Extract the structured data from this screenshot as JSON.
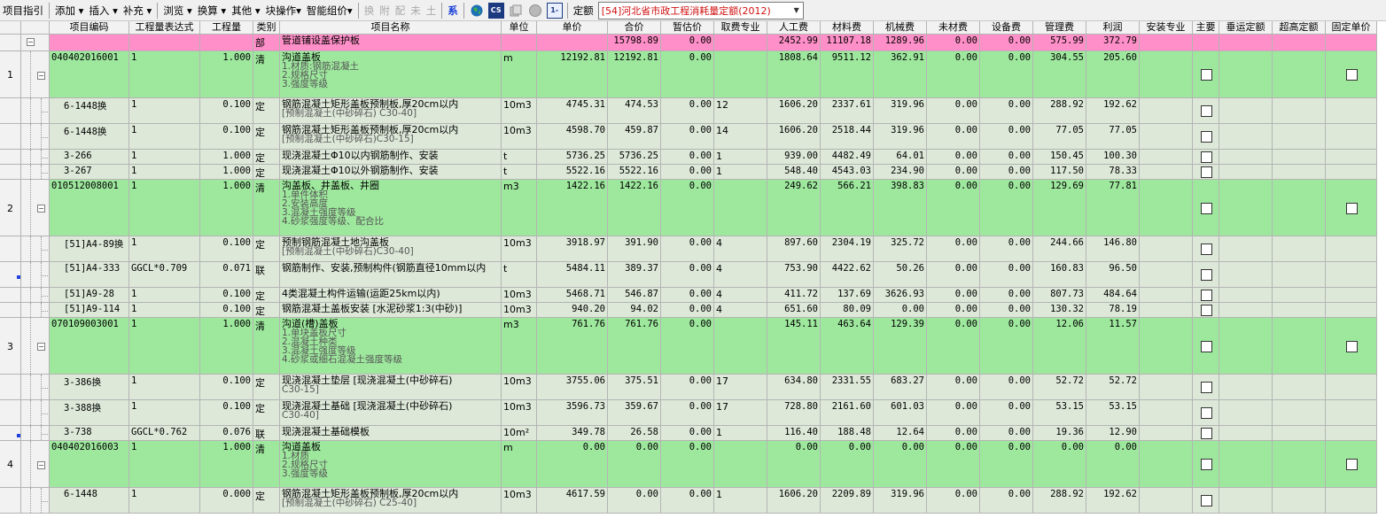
{
  "toolbar": {
    "items": [
      {
        "label": "项目指引",
        "icon": "",
        "state": "normal"
      },
      {
        "label": "sep"
      },
      {
        "label": "添加 ▾",
        "state": "normal"
      },
      {
        "label": "插入 ▾",
        "state": "normal"
      },
      {
        "label": "补充 ▾",
        "state": "normal"
      },
      {
        "label": "sep"
      },
      {
        "label": "浏览 ▾",
        "state": "normal"
      },
      {
        "label": "换算 ▾",
        "state": "normal"
      },
      {
        "label": "其他 ▾",
        "state": "normal"
      },
      {
        "label": "块操作▾",
        "state": "normal"
      },
      {
        "label": "智能组价▾",
        "state": "normal"
      },
      {
        "label": "sep"
      },
      {
        "label": "换",
        "state": "disabled"
      },
      {
        "label": "附",
        "state": "disabled"
      },
      {
        "label": "配",
        "state": "disabled"
      },
      {
        "label": "未",
        "state": "disabled"
      },
      {
        "label": "土",
        "state": "disabled"
      },
      {
        "label": "sep"
      },
      {
        "label": "系",
        "state": "blue"
      },
      {
        "label": "sep"
      }
    ],
    "icons": [
      "map-icon",
      "cs-icon",
      "copy-icon",
      "circle-icon",
      "screen-icon"
    ],
    "icon_cs_text": "CS",
    "icon_screen_text": "1-",
    "quota_label": "定额",
    "quota_value": "[54]河北省市政工程消耗量定额(2012)"
  },
  "columns": [
    {
      "key": "idx",
      "label": ""
    },
    {
      "key": "tree",
      "label": ""
    },
    {
      "key": "code",
      "label": "项目编码"
    },
    {
      "key": "expr",
      "label": "工程量表达式"
    },
    {
      "key": "qty",
      "label": "工程量"
    },
    {
      "key": "type",
      "label": "类别"
    },
    {
      "key": "name",
      "label": "项目名称"
    },
    {
      "key": "unit",
      "label": "单位"
    },
    {
      "key": "price",
      "label": "单价"
    },
    {
      "key": "total",
      "label": "合价"
    },
    {
      "key": "est",
      "label": "暂估价"
    },
    {
      "key": "fee",
      "label": "取费专业"
    },
    {
      "key": "labor",
      "label": "人工费"
    },
    {
      "key": "mat",
      "label": "材料费"
    },
    {
      "key": "mach",
      "label": "机械费"
    },
    {
      "key": "unmat",
      "label": "未材费"
    },
    {
      "key": "equip",
      "label": "设备费"
    },
    {
      "key": "mgmt",
      "label": "管理费"
    },
    {
      "key": "profit",
      "label": "利润"
    },
    {
      "key": "install",
      "label": "安装专业"
    },
    {
      "key": "main",
      "label": "主要"
    },
    {
      "key": "transport",
      "label": "垂运定额"
    },
    {
      "key": "ultra",
      "label": "超高定额"
    },
    {
      "key": "fixed",
      "label": "固定单价"
    }
  ],
  "rows": [
    {
      "kind": "part",
      "idx": "",
      "code": "",
      "expr": "",
      "qty": "",
      "type": "部",
      "name": "管道铺设盖保护板",
      "sub": [],
      "unit": "",
      "price": "",
      "total": "15798.89",
      "est": "0.00",
      "fee": "",
      "labor": "2452.99",
      "mat": "11107.18",
      "mach": "1289.96",
      "unmat": "0.00",
      "equip": "0.00",
      "mgmt": "575.99",
      "profit": "372.79",
      "main_cb": false,
      "fixed_cb": false
    },
    {
      "kind": "list",
      "idx": "1",
      "code": "040402016001",
      "expr": "1",
      "qty": "1.000",
      "type": "清",
      "name": "沟道盖板",
      "sub": [
        "1.材质:钢筋混凝土",
        "2.规格尺寸",
        "3.强度等级"
      ],
      "unit": "m",
      "price": "12192.81",
      "total": "12192.81",
      "est": "0.00",
      "fee": "",
      "labor": "1808.64",
      "mat": "9511.12",
      "mach": "362.91",
      "unmat": "0.00",
      "equip": "0.00",
      "mgmt": "304.55",
      "profit": "205.60",
      "main_cb": true,
      "fixed_cb": true
    },
    {
      "kind": "item",
      "idx": "",
      "code": "6-1448换",
      "expr": "1",
      "qty": "0.100",
      "type": "定",
      "name": "钢筋混凝土矩形盖板预制板,厚20cm以内",
      "sub": [
        "[预制混凝土(中砂碎石) C30-40]"
      ],
      "unit": "10m3",
      "price": "4745.31",
      "total": "474.53",
      "est": "0.00",
      "fee": "12",
      "labor": "1606.20",
      "mat": "2337.61",
      "mach": "319.96",
      "unmat": "0.00",
      "equip": "0.00",
      "mgmt": "288.92",
      "profit": "192.62",
      "main_cb": true,
      "fixed_cb": false
    },
    {
      "kind": "item",
      "idx": "",
      "code": "6-1448换",
      "expr": "1",
      "qty": "0.100",
      "type": "定",
      "name": "钢筋混凝土矩形盖板预制板,厚20cm以内",
      "sub": [
        "[预制混凝土(中砂碎石)C30-15]"
      ],
      "unit": "10m3",
      "price": "4598.70",
      "total": "459.87",
      "est": "0.00",
      "fee": "14",
      "labor": "1606.20",
      "mat": "2518.44",
      "mach": "319.96",
      "unmat": "0.00",
      "equip": "0.00",
      "mgmt": "77.05",
      "profit": "77.05",
      "main_cb": true,
      "fixed_cb": false
    },
    {
      "kind": "item",
      "idx": "",
      "code": "3-266",
      "expr": "1",
      "qty": "1.000",
      "type": "定",
      "name": "现浇混凝土Φ10以内钢筋制作、安装",
      "sub": [],
      "unit": "t",
      "price": "5736.25",
      "total": "5736.25",
      "est": "0.00",
      "fee": "1",
      "labor": "939.00",
      "mat": "4482.49",
      "mach": "64.01",
      "unmat": "0.00",
      "equip": "0.00",
      "mgmt": "150.45",
      "profit": "100.30",
      "main_cb": true,
      "fixed_cb": false
    },
    {
      "kind": "item",
      "idx": "",
      "code": "3-267",
      "expr": "1",
      "qty": "1.000",
      "type": "定",
      "name": "现浇混凝土Φ10以外钢筋制作、安装",
      "sub": [],
      "unit": "t",
      "price": "5522.16",
      "total": "5522.16",
      "est": "0.00",
      "fee": "1",
      "labor": "548.40",
      "mat": "4543.03",
      "mach": "234.90",
      "unmat": "0.00",
      "equip": "0.00",
      "mgmt": "117.50",
      "profit": "78.33",
      "main_cb": true,
      "fixed_cb": false
    },
    {
      "kind": "list",
      "idx": "2",
      "code": "010512008001",
      "expr": "1",
      "qty": "1.000",
      "type": "清",
      "name": "沟盖板、井盖板、井圈",
      "sub": [
        "1.单件体积",
        "2.安装高度",
        "3.混凝土强度等级",
        "4.砂浆强度等级、配合比"
      ],
      "unit": "m3",
      "price": "1422.16",
      "total": "1422.16",
      "est": "0.00",
      "fee": "",
      "labor": "249.62",
      "mat": "566.21",
      "mach": "398.83",
      "unmat": "0.00",
      "equip": "0.00",
      "mgmt": "129.69",
      "profit": "77.81",
      "main_cb": true,
      "fixed_cb": true
    },
    {
      "kind": "item",
      "idx": "",
      "code": "[51]A4-89换",
      "expr": "1",
      "qty": "0.100",
      "type": "定",
      "name": "预制钢筋混凝土地沟盖板",
      "sub": [
        "[预制混凝土(中砂碎石)C30-40]"
      ],
      "unit": "10m3",
      "price": "3918.97",
      "total": "391.90",
      "est": "0.00",
      "fee": "4",
      "labor": "897.60",
      "mat": "2304.19",
      "mach": "325.72",
      "unmat": "0.00",
      "equip": "0.00",
      "mgmt": "244.66",
      "profit": "146.80",
      "main_cb": true,
      "fixed_cb": false
    },
    {
      "kind": "item",
      "idx": "",
      "code": "[51]A4-333",
      "expr": "GGCL*0.709",
      "qty": "0.071",
      "type": "联",
      "name": "钢筋制作、安装,预制构件(钢筋直径10mm以内",
      "sub": [],
      "unit": "t",
      "price": "5484.11",
      "total": "389.37",
      "est": "0.00",
      "fee": "4",
      "labor": "753.90",
      "mat": "4422.62",
      "mach": "50.26",
      "unmat": "0.00",
      "equip": "0.00",
      "mgmt": "160.83",
      "profit": "96.50",
      "main_cb": true,
      "fixed_cb": false,
      "marker": true
    },
    {
      "kind": "item",
      "idx": "",
      "code": "[51]A9-28",
      "expr": "1",
      "qty": "0.100",
      "type": "定",
      "name": "4类混凝土构件运输(运距25km以内)",
      "sub": [],
      "unit": "10m3",
      "price": "5468.71",
      "total": "546.87",
      "est": "0.00",
      "fee": "4",
      "labor": "411.72",
      "mat": "137.69",
      "mach": "3626.93",
      "unmat": "0.00",
      "equip": "0.00",
      "mgmt": "807.73",
      "profit": "484.64",
      "main_cb": true,
      "fixed_cb": false
    },
    {
      "kind": "item",
      "idx": "",
      "code": "[51]A9-114",
      "expr": "1",
      "qty": "0.100",
      "type": "定",
      "name": "钢筋混凝土盖板安装 [水泥砂浆1:3(中砂)]",
      "sub": [],
      "unit": "10m3",
      "price": "940.20",
      "total": "94.02",
      "est": "0.00",
      "fee": "4",
      "labor": "651.60",
      "mat": "80.09",
      "mach": "0.00",
      "unmat": "0.00",
      "equip": "0.00",
      "mgmt": "130.32",
      "profit": "78.19",
      "main_cb": true,
      "fixed_cb": false
    },
    {
      "kind": "list",
      "idx": "3",
      "code": "070109003001",
      "expr": "1",
      "qty": "1.000",
      "type": "清",
      "name": "沟道(槽)盖板",
      "sub": [
        "1.单块盖板尺寸",
        "2.混凝土种类",
        "3.混凝土强度等级",
        "4.砂浆或细石混凝土强度等级"
      ],
      "unit": "m3",
      "price": "761.76",
      "total": "761.76",
      "est": "0.00",
      "fee": "",
      "labor": "145.11",
      "mat": "463.64",
      "mach": "129.39",
      "unmat": "0.00",
      "equip": "0.00",
      "mgmt": "12.06",
      "profit": "11.57",
      "main_cb": true,
      "fixed_cb": true
    },
    {
      "kind": "item",
      "idx": "",
      "code": "3-386换",
      "expr": "1",
      "qty": "0.100",
      "type": "定",
      "name": "现浇混凝土垫层 [现浇混凝土(中砂碎石)",
      "sub": [
        "C30-15]"
      ],
      "unit": "10m3",
      "price": "3755.06",
      "total": "375.51",
      "est": "0.00",
      "fee": "17",
      "labor": "634.80",
      "mat": "2331.55",
      "mach": "683.27",
      "unmat": "0.00",
      "equip": "0.00",
      "mgmt": "52.72",
      "profit": "52.72",
      "main_cb": true,
      "fixed_cb": false
    },
    {
      "kind": "item",
      "idx": "",
      "code": "3-388换",
      "expr": "1",
      "qty": "0.100",
      "type": "定",
      "name": "现浇混凝土基础 [现浇混凝土(中砂碎石)",
      "sub": [
        "C30-40]"
      ],
      "unit": "10m3",
      "price": "3596.73",
      "total": "359.67",
      "est": "0.00",
      "fee": "17",
      "labor": "728.80",
      "mat": "2161.60",
      "mach": "601.03",
      "unmat": "0.00",
      "equip": "0.00",
      "mgmt": "53.15",
      "profit": "53.15",
      "main_cb": true,
      "fixed_cb": false
    },
    {
      "kind": "item",
      "idx": "",
      "code": "3-738",
      "expr": "GGCL*0.762",
      "qty": "0.076",
      "type": "联",
      "name": "现浇混凝土基础模板",
      "sub": [],
      "unit": "10m²",
      "price": "349.78",
      "total": "26.58",
      "est": "0.00",
      "fee": "1",
      "labor": "116.40",
      "mat": "188.48",
      "mach": "12.64",
      "unmat": "0.00",
      "equip": "0.00",
      "mgmt": "19.36",
      "profit": "12.90",
      "main_cb": true,
      "fixed_cb": false,
      "marker": true
    },
    {
      "kind": "list",
      "idx": "4",
      "code": "040402016003",
      "expr": "1",
      "qty": "1.000",
      "type": "清",
      "name": "沟道盖板",
      "sub": [
        "1.材质",
        "2.规格尺寸",
        "3.强度等级"
      ],
      "unit": "m",
      "price": "0.00",
      "total": "0.00",
      "est": "0.00",
      "fee": "",
      "labor": "0.00",
      "mat": "0.00",
      "mach": "0.00",
      "unmat": "0.00",
      "equip": "0.00",
      "mgmt": "0.00",
      "profit": "0.00",
      "main_cb": true,
      "fixed_cb": true
    },
    {
      "kind": "item",
      "idx": "",
      "code": "6-1448",
      "expr": "1",
      "qty": "0.000",
      "type": "定",
      "name": "钢筋混凝土矩形盖板预制板,厚20cm以内",
      "sub": [
        "[预制混凝土(中砂碎石) C25-40]"
      ],
      "unit": "10m3",
      "price": "4617.59",
      "total": "0.00",
      "est": "0.00",
      "fee": "1",
      "labor": "1606.20",
      "mat": "2209.89",
      "mach": "319.96",
      "unmat": "0.00",
      "equip": "0.00",
      "mgmt": "288.92",
      "profit": "192.62",
      "main_cb": true,
      "fixed_cb": false
    }
  ]
}
